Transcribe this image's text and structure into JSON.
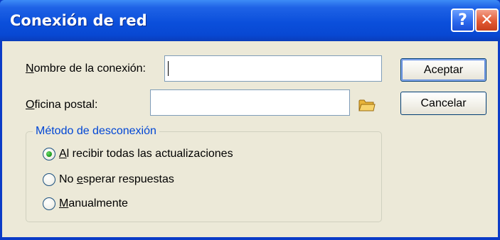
{
  "window": {
    "title": "Conexión de red",
    "help_glyph": "?",
    "close_glyph": "✕"
  },
  "form": {
    "connection_name": {
      "label_mnemonic": "N",
      "label_rest": "ombre de la conexión:",
      "value": ""
    },
    "post_office": {
      "label_mnemonic": "O",
      "label_rest": "ficina postal:",
      "value": "",
      "browse_icon": "folder-icon"
    }
  },
  "buttons": {
    "ok_label": "Aceptar",
    "cancel_label": "Cancelar"
  },
  "disconnect_method": {
    "legend": "Método de desconexión",
    "options": [
      {
        "pre": "",
        "mnemonic": "A",
        "post": "l recibir todas las actualizaciones",
        "selected": true
      },
      {
        "pre": "No ",
        "mnemonic": "e",
        "post": "sperar respuestas",
        "selected": false
      },
      {
        "pre": "",
        "mnemonic": "M",
        "post": "anualmente",
        "selected": false
      }
    ]
  },
  "colors": {
    "titlebar": "#0b4fdb",
    "client_bg": "#ece9d8",
    "legend_text": "#0046d5",
    "close_button": "#e35a33"
  }
}
